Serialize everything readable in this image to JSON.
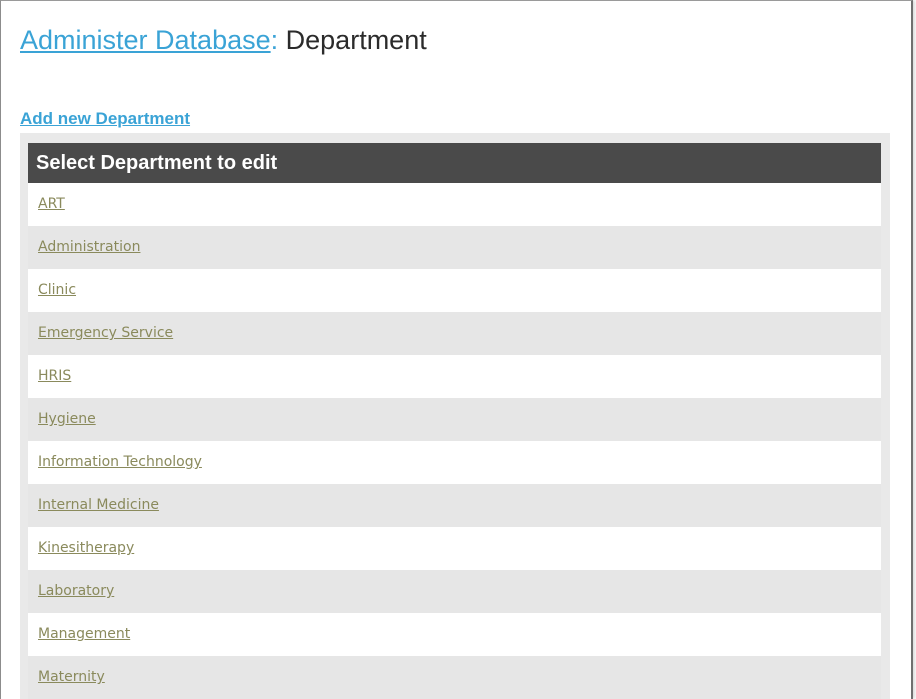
{
  "header": {
    "breadcrumb_link": "Administer Database",
    "separator": ":",
    "page_title": "Department"
  },
  "actions": {
    "add_new": "Add new Department"
  },
  "table": {
    "header": "Select Department to edit",
    "departments": [
      "ART",
      "Administration",
      "Clinic",
      "Emergency Service",
      "HRIS",
      "Hygiene",
      "Information Technology",
      "Internal Medicine",
      "Kinesitherapy",
      "Laboratory",
      "Management",
      "Maternity"
    ]
  },
  "colors": {
    "link_blue": "#3aa3d6",
    "header_bg": "#4a4a4a",
    "row_alt": "#e6e6e6",
    "row_link": "#8a8a5c"
  }
}
